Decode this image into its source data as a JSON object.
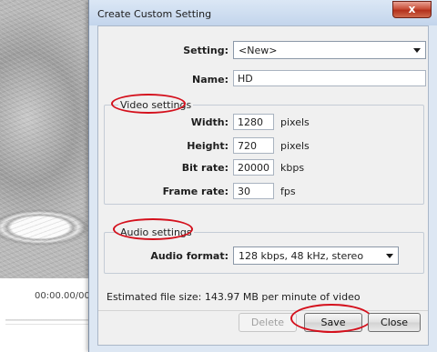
{
  "player": {
    "timecode": "00:00.00/00:"
  },
  "dialog": {
    "title": "Create Custom Setting",
    "close_glyph": "x",
    "setting_label": "Setting:",
    "setting_value": "<New>",
    "name_label": "Name:",
    "name_value": "HD",
    "video_group_title": "Video settings",
    "width_label": "Width:",
    "width_value": "1280",
    "width_unit": "pixels",
    "height_label": "Height:",
    "height_value": "720",
    "height_unit": "pixels",
    "bitrate_label": "Bit rate:",
    "bitrate_value": "20000",
    "bitrate_unit": "kbps",
    "framerate_label": "Frame rate:",
    "framerate_value": "30",
    "framerate_unit": "fps",
    "audio_group_title": "Audio settings",
    "audio_format_label": "Audio format:",
    "audio_format_value": "128 kbps, 48 kHz, stereo",
    "status_text": "Estimated file size: 143.97 MB per minute of video",
    "delete_label": "Delete",
    "save_label": "Save",
    "close_label": "Close"
  },
  "colors": {
    "annotation_ring": "#d4101c",
    "close_button": "#c9503a"
  }
}
